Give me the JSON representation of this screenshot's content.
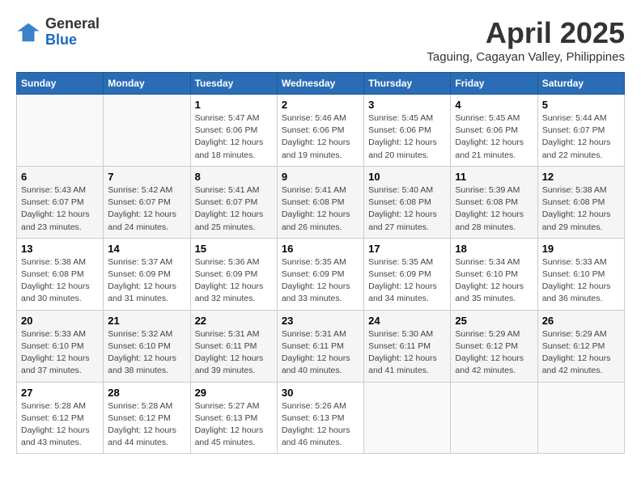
{
  "header": {
    "logo_general": "General",
    "logo_blue": "Blue",
    "title": "April 2025",
    "location": "Taguing, Cagayan Valley, Philippines"
  },
  "weekdays": [
    "Sunday",
    "Monday",
    "Tuesday",
    "Wednesday",
    "Thursday",
    "Friday",
    "Saturday"
  ],
  "weeks": [
    [
      {
        "day": "",
        "sunrise": "",
        "sunset": "",
        "daylight": ""
      },
      {
        "day": "",
        "sunrise": "",
        "sunset": "",
        "daylight": ""
      },
      {
        "day": "1",
        "sunrise": "Sunrise: 5:47 AM",
        "sunset": "Sunset: 6:06 PM",
        "daylight": "Daylight: 12 hours and 18 minutes."
      },
      {
        "day": "2",
        "sunrise": "Sunrise: 5:46 AM",
        "sunset": "Sunset: 6:06 PM",
        "daylight": "Daylight: 12 hours and 19 minutes."
      },
      {
        "day": "3",
        "sunrise": "Sunrise: 5:45 AM",
        "sunset": "Sunset: 6:06 PM",
        "daylight": "Daylight: 12 hours and 20 minutes."
      },
      {
        "day": "4",
        "sunrise": "Sunrise: 5:45 AM",
        "sunset": "Sunset: 6:06 PM",
        "daylight": "Daylight: 12 hours and 21 minutes."
      },
      {
        "day": "5",
        "sunrise": "Sunrise: 5:44 AM",
        "sunset": "Sunset: 6:07 PM",
        "daylight": "Daylight: 12 hours and 22 minutes."
      }
    ],
    [
      {
        "day": "6",
        "sunrise": "Sunrise: 5:43 AM",
        "sunset": "Sunset: 6:07 PM",
        "daylight": "Daylight: 12 hours and 23 minutes."
      },
      {
        "day": "7",
        "sunrise": "Sunrise: 5:42 AM",
        "sunset": "Sunset: 6:07 PM",
        "daylight": "Daylight: 12 hours and 24 minutes."
      },
      {
        "day": "8",
        "sunrise": "Sunrise: 5:41 AM",
        "sunset": "Sunset: 6:07 PM",
        "daylight": "Daylight: 12 hours and 25 minutes."
      },
      {
        "day": "9",
        "sunrise": "Sunrise: 5:41 AM",
        "sunset": "Sunset: 6:08 PM",
        "daylight": "Daylight: 12 hours and 26 minutes."
      },
      {
        "day": "10",
        "sunrise": "Sunrise: 5:40 AM",
        "sunset": "Sunset: 6:08 PM",
        "daylight": "Daylight: 12 hours and 27 minutes."
      },
      {
        "day": "11",
        "sunrise": "Sunrise: 5:39 AM",
        "sunset": "Sunset: 6:08 PM",
        "daylight": "Daylight: 12 hours and 28 minutes."
      },
      {
        "day": "12",
        "sunrise": "Sunrise: 5:38 AM",
        "sunset": "Sunset: 6:08 PM",
        "daylight": "Daylight: 12 hours and 29 minutes."
      }
    ],
    [
      {
        "day": "13",
        "sunrise": "Sunrise: 5:38 AM",
        "sunset": "Sunset: 6:08 PM",
        "daylight": "Daylight: 12 hours and 30 minutes."
      },
      {
        "day": "14",
        "sunrise": "Sunrise: 5:37 AM",
        "sunset": "Sunset: 6:09 PM",
        "daylight": "Daylight: 12 hours and 31 minutes."
      },
      {
        "day": "15",
        "sunrise": "Sunrise: 5:36 AM",
        "sunset": "Sunset: 6:09 PM",
        "daylight": "Daylight: 12 hours and 32 minutes."
      },
      {
        "day": "16",
        "sunrise": "Sunrise: 5:35 AM",
        "sunset": "Sunset: 6:09 PM",
        "daylight": "Daylight: 12 hours and 33 minutes."
      },
      {
        "day": "17",
        "sunrise": "Sunrise: 5:35 AM",
        "sunset": "Sunset: 6:09 PM",
        "daylight": "Daylight: 12 hours and 34 minutes."
      },
      {
        "day": "18",
        "sunrise": "Sunrise: 5:34 AM",
        "sunset": "Sunset: 6:10 PM",
        "daylight": "Daylight: 12 hours and 35 minutes."
      },
      {
        "day": "19",
        "sunrise": "Sunrise: 5:33 AM",
        "sunset": "Sunset: 6:10 PM",
        "daylight": "Daylight: 12 hours and 36 minutes."
      }
    ],
    [
      {
        "day": "20",
        "sunrise": "Sunrise: 5:33 AM",
        "sunset": "Sunset: 6:10 PM",
        "daylight": "Daylight: 12 hours and 37 minutes."
      },
      {
        "day": "21",
        "sunrise": "Sunrise: 5:32 AM",
        "sunset": "Sunset: 6:10 PM",
        "daylight": "Daylight: 12 hours and 38 minutes."
      },
      {
        "day": "22",
        "sunrise": "Sunrise: 5:31 AM",
        "sunset": "Sunset: 6:11 PM",
        "daylight": "Daylight: 12 hours and 39 minutes."
      },
      {
        "day": "23",
        "sunrise": "Sunrise: 5:31 AM",
        "sunset": "Sunset: 6:11 PM",
        "daylight": "Daylight: 12 hours and 40 minutes."
      },
      {
        "day": "24",
        "sunrise": "Sunrise: 5:30 AM",
        "sunset": "Sunset: 6:11 PM",
        "daylight": "Daylight: 12 hours and 41 minutes."
      },
      {
        "day": "25",
        "sunrise": "Sunrise: 5:29 AM",
        "sunset": "Sunset: 6:12 PM",
        "daylight": "Daylight: 12 hours and 42 minutes."
      },
      {
        "day": "26",
        "sunrise": "Sunrise: 5:29 AM",
        "sunset": "Sunset: 6:12 PM",
        "daylight": "Daylight: 12 hours and 42 minutes."
      }
    ],
    [
      {
        "day": "27",
        "sunrise": "Sunrise: 5:28 AM",
        "sunset": "Sunset: 6:12 PM",
        "daylight": "Daylight: 12 hours and 43 minutes."
      },
      {
        "day": "28",
        "sunrise": "Sunrise: 5:28 AM",
        "sunset": "Sunset: 6:12 PM",
        "daylight": "Daylight: 12 hours and 44 minutes."
      },
      {
        "day": "29",
        "sunrise": "Sunrise: 5:27 AM",
        "sunset": "Sunset: 6:13 PM",
        "daylight": "Daylight: 12 hours and 45 minutes."
      },
      {
        "day": "30",
        "sunrise": "Sunrise: 5:26 AM",
        "sunset": "Sunset: 6:13 PM",
        "daylight": "Daylight: 12 hours and 46 minutes."
      },
      {
        "day": "",
        "sunrise": "",
        "sunset": "",
        "daylight": ""
      },
      {
        "day": "",
        "sunrise": "",
        "sunset": "",
        "daylight": ""
      },
      {
        "day": "",
        "sunrise": "",
        "sunset": "",
        "daylight": ""
      }
    ]
  ]
}
